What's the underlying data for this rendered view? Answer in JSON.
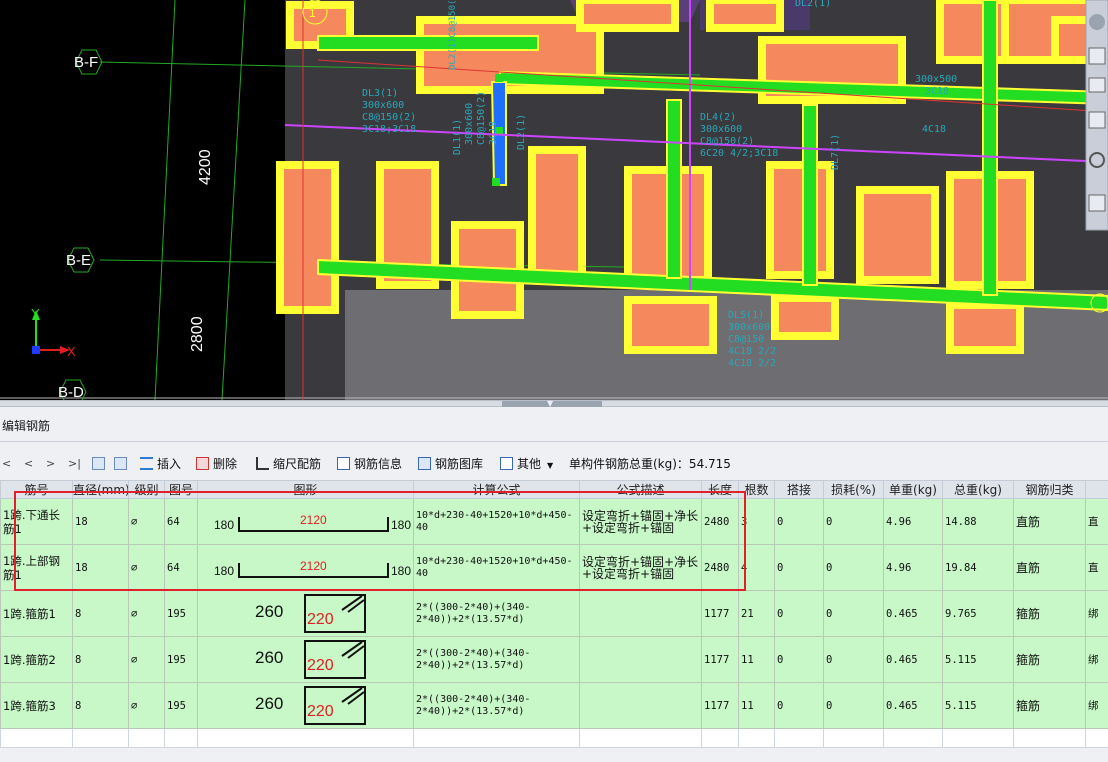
{
  "viewport": {
    "axes": {
      "grid_labels": [
        "B-F",
        "B-E",
        "B-D"
      ],
      "dims": [
        "4200",
        "2800"
      ],
      "y_axis": "Y",
      "x_axis": "X"
    },
    "beam_labels": {
      "dl3": [
        "DL3(1)",
        "300x600",
        "C8@150(2)",
        "3C18;3C18"
      ],
      "dl1": [
        "DL1(1)",
        "300x600",
        "C8@150(2)",
        "3C18"
      ],
      "dl4": [
        "DL4(2)",
        "300x600",
        "C8@150(2)",
        "6C20 4/2;3C18"
      ],
      "dl2": "DL2(1)",
      "dl7": "DL7(1)",
      "right_label": [
        "300x500",
        "3C18"
      ],
      "mid_label": "4C18",
      "top_label": "DL2(1)",
      "vertical_top": "DL2(1)C8@150(2)300x400 3C18;3C18",
      "bottom_label": [
        "DL5(1)",
        "300x600",
        "C8@150",
        "4C18 2/2",
        "4C18 2/2"
      ]
    },
    "circle_marker": "1"
  },
  "panel": {
    "title": "编辑钢筋",
    "toolbar": {
      "nav": [
        "<",
        "<",
        ">",
        ">|"
      ],
      "insert": "插入",
      "delete": "删除",
      "scale_rebar": "缩尺配筋",
      "rebar_info": "钢筋信息",
      "rebar_library": "钢筋图库",
      "other": "其他",
      "total_weight": "单构件钢筋总重(kg)：54.715"
    },
    "columns": [
      "筋号",
      "直径(mm)",
      "级别",
      "图号",
      "图形",
      "计算公式",
      "公式描述",
      "长度",
      "根数",
      "搭接",
      "损耗(%)",
      "单重(kg)",
      "总重(kg)",
      "钢筋归类",
      "搭"
    ],
    "rows": [
      {
        "name": "1跨.下通长筋1",
        "dia": "18",
        "grade": "⌀",
        "fig": "64",
        "shape": {
          "type": "line",
          "left": "180",
          "mid": "2120",
          "right": "180"
        },
        "formula": "10*d+230-40+1520+10*d+450-40",
        "desc": "设定弯折+锚固+净长+设定弯折+锚固",
        "length": "2480",
        "count": "3",
        "lap": "0",
        "loss": "0",
        "unit": "4.96",
        "total": "14.88",
        "cat": "直筋",
        "extra": "直"
      },
      {
        "name": "1跨.上部钢筋1",
        "dia": "18",
        "grade": "⌀",
        "fig": "64",
        "shape": {
          "type": "line",
          "left": "180",
          "mid": "2120",
          "right": "180"
        },
        "formula": "10*d+230-40+1520+10*d+450-40",
        "desc": "设定弯折+锚固+净长+设定弯折+锚固",
        "length": "2480",
        "count": "4",
        "lap": "0",
        "loss": "0",
        "unit": "4.96",
        "total": "19.84",
        "cat": "直筋",
        "extra": "直"
      },
      {
        "name": "1跨.箍筋1",
        "dia": "8",
        "grade": "⌀",
        "fig": "195",
        "shape": {
          "type": "stirrup",
          "left": "260",
          "inner": "220"
        },
        "formula": "2*((300-2*40)+(340-2*40))+2*(13.57*d)",
        "desc": "",
        "length": "1177",
        "count": "21",
        "lap": "0",
        "loss": "0",
        "unit": "0.465",
        "total": "9.765",
        "cat": "箍筋",
        "extra": "绑"
      },
      {
        "name": "1跨.箍筋2",
        "dia": "8",
        "grade": "⌀",
        "fig": "195",
        "shape": {
          "type": "stirrup",
          "left": "260",
          "inner": "220"
        },
        "formula": "2*((300-2*40)+(340-2*40))+2*(13.57*d)",
        "desc": "",
        "length": "1177",
        "count": "11",
        "lap": "0",
        "loss": "0",
        "unit": "0.465",
        "total": "5.115",
        "cat": "箍筋",
        "extra": "绑"
      },
      {
        "name": "1跨.箍筋3",
        "dia": "8",
        "grade": "⌀",
        "fig": "195",
        "shape": {
          "type": "stirrup",
          "left": "260",
          "inner": "220"
        },
        "formula": "2*((300-2*40)+(340-2*40))+2*(13.57*d)",
        "desc": "",
        "length": "1177",
        "count": "11",
        "lap": "0",
        "loss": "0",
        "unit": "0.465",
        "total": "5.115",
        "cat": "箍筋",
        "extra": "绑"
      }
    ]
  },
  "colors": {
    "accent_select": "#e0202a",
    "row_bg": "#c8f7c8",
    "cad_bg": "#000000",
    "footing": "#f5885c",
    "footing_border": "#ffff33",
    "beam": "#22dd22",
    "selected_beam": "#1e6fff",
    "axis_line": "#cc44ff"
  }
}
